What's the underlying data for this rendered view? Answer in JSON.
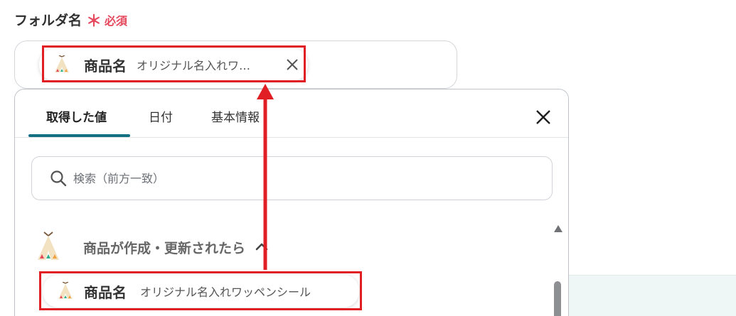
{
  "field": {
    "label": "フォルダ名",
    "required_mark": "＊",
    "required_text": "必須"
  },
  "selected_chip": {
    "name": "商品名",
    "value": "オリジナル名入れワ…",
    "icon": "teepee-icon",
    "remove_icon": "close-icon"
  },
  "dropdown": {
    "tabs": [
      {
        "label": "取得した値",
        "active": true
      },
      {
        "label": "日付",
        "active": false
      },
      {
        "label": "基本情報",
        "active": false
      }
    ],
    "close_icon": "close-icon",
    "search": {
      "placeholder": "検索（前方一致）",
      "value": "",
      "icon": "search-icon"
    },
    "group": {
      "title": "商品が作成・更新されたら",
      "icon": "teepee-icon",
      "expanded": true,
      "items": [
        {
          "name": "商品名",
          "value": "オリジナル名入れワッペンシール",
          "icon": "teepee-icon"
        }
      ]
    }
  },
  "colors": {
    "accent": "#137081",
    "required": "#e5485d",
    "highlight": "#e01e24"
  }
}
